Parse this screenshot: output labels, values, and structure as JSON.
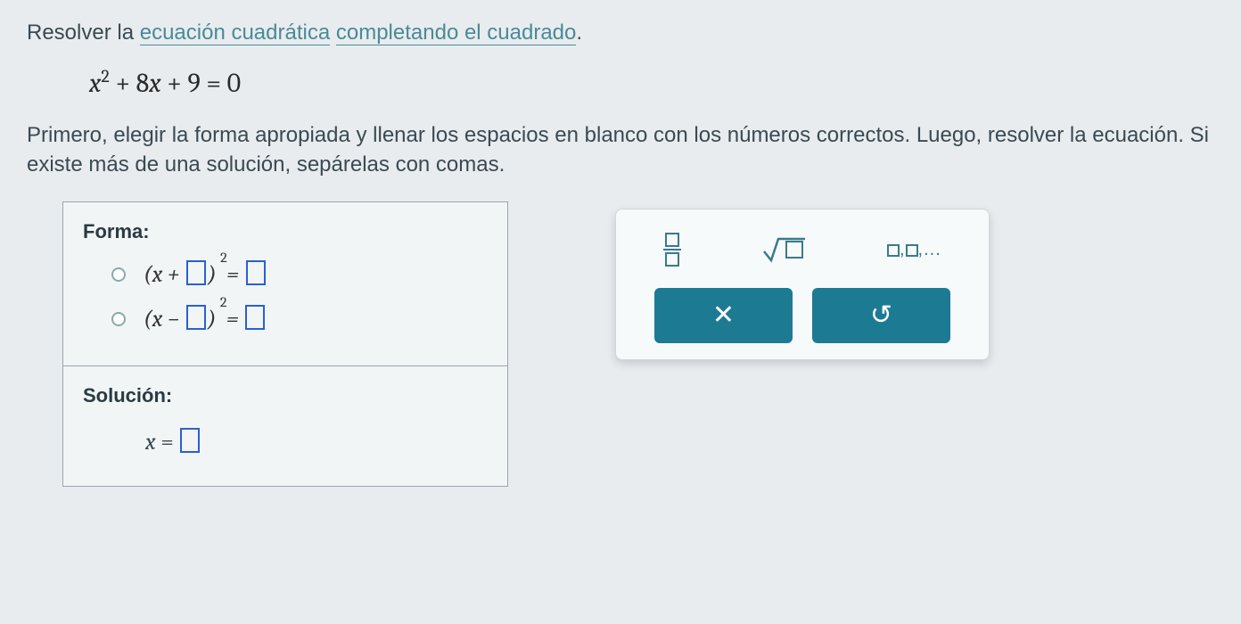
{
  "prompt": {
    "pre": "Resolver la ",
    "link1": "ecuación cuadrática",
    "mid": " ",
    "link2": "completando el cuadrado",
    "post": "."
  },
  "equation": {
    "display": "x² + 8x + 9 = 0",
    "a": 1,
    "b": 8,
    "c": 9
  },
  "instructions": "Primero, elegir la forma apropiada y llenar los espacios en blanco con los números correctos. Luego, resolver la ecuación. Si existe más de una solución, sepárelas con comas.",
  "answer_box": {
    "forma_label": "Forma:",
    "options": [
      {
        "template": "(x + □)² = □",
        "selected": false
      },
      {
        "template": "(x − □)² = □",
        "selected": false
      }
    ],
    "solucion_label": "Solución:",
    "solution_template": "x = □"
  },
  "toolpanel": {
    "tools": [
      {
        "name": "fraction",
        "semantic": "fraction-icon"
      },
      {
        "name": "sqrt",
        "semantic": "sqrt-icon"
      },
      {
        "name": "list",
        "semantic": "list-icon",
        "display": "□,□,..."
      }
    ],
    "buttons": [
      {
        "name": "clear",
        "glyph": "✕"
      },
      {
        "name": "reset",
        "glyph": "↺"
      }
    ]
  },
  "colors": {
    "link": "#4a8a96",
    "blank_border": "#2a5fd4",
    "button_bg": "#1d7a93"
  }
}
